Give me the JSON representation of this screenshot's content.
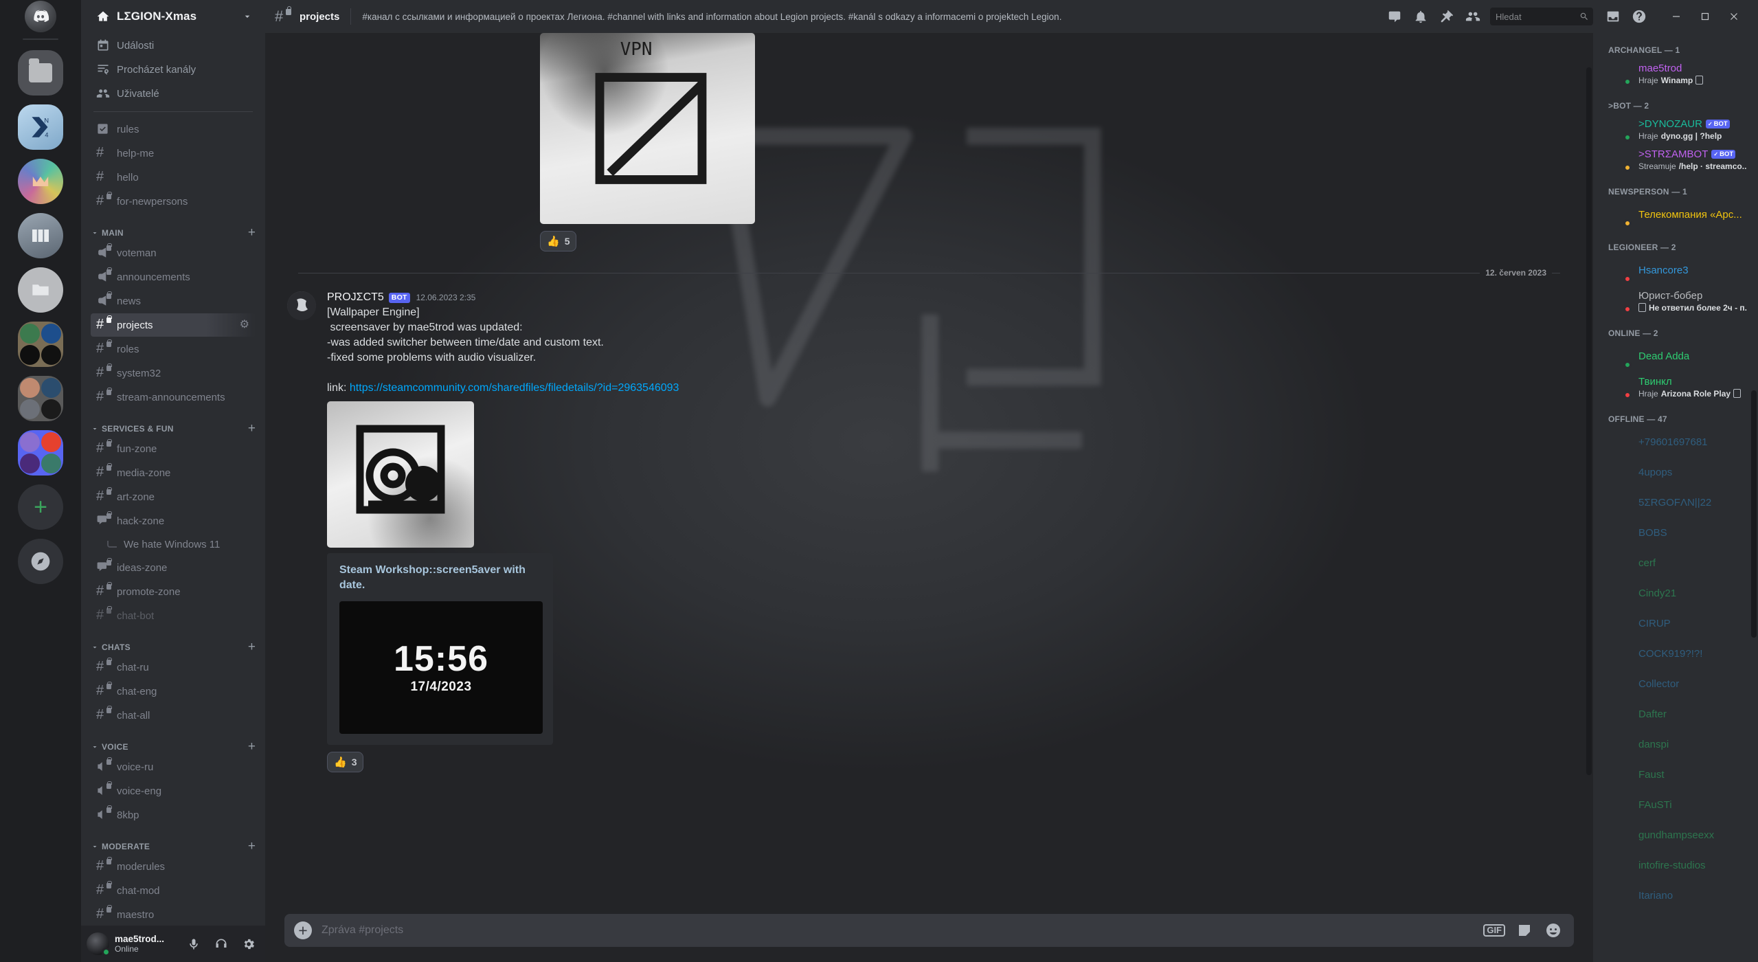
{
  "titlebar": {
    "server_name": "LΣGION-Xmas",
    "channel_name": "projects",
    "topic": "#канал с ссылками и информацией о проектах Легиона. #channel with links and information about Legion projects. #kanál s odkazy a informacemi o projektech Legion.",
    "search_placeholder": "Hledat",
    "icons": [
      "threads-icon",
      "notification-bell-icon",
      "pin-icon",
      "members-icon",
      "inbox-icon",
      "help-icon"
    ],
    "window_controls": [
      "minimize-icon",
      "maximize-icon",
      "close-icon"
    ]
  },
  "sidebar": {
    "nav": [
      {
        "label": "Události",
        "icon": "calendar-icon"
      },
      {
        "label": "Procházet kanály",
        "icon": "browse-channels-icon"
      },
      {
        "label": "Uživatelé",
        "icon": "members-icon"
      }
    ],
    "top_channels": [
      {
        "name": "rules",
        "icon": "rules-icon",
        "locked": false
      },
      {
        "name": "help-me",
        "icon": "hash",
        "locked": false
      },
      {
        "name": "hello",
        "icon": "hash",
        "locked": false
      },
      {
        "name": "for-newpersons",
        "icon": "hash",
        "locked": true
      }
    ],
    "categories": [
      {
        "name": "MAIN",
        "channels": [
          {
            "name": "voteman",
            "icon": "announcement",
            "locked": true
          },
          {
            "name": "announcements",
            "icon": "announcement",
            "locked": true
          },
          {
            "name": "news",
            "icon": "announcement",
            "locked": true
          },
          {
            "name": "projects",
            "icon": "hash",
            "locked": true,
            "active": true
          },
          {
            "name": "roles",
            "icon": "hash",
            "locked": true
          },
          {
            "name": "system32",
            "icon": "hash",
            "locked": true
          },
          {
            "name": "stream-announcements",
            "icon": "hash",
            "locked": true
          }
        ]
      },
      {
        "name": "SERVICES & FUN",
        "channels": [
          {
            "name": "fun-zone",
            "icon": "hash",
            "locked": true
          },
          {
            "name": "media-zone",
            "icon": "hash",
            "locked": true
          },
          {
            "name": "art-zone",
            "icon": "hash",
            "locked": true
          },
          {
            "name": "hack-zone",
            "icon": "forum",
            "locked": true
          },
          {
            "name": "We hate Windows 11",
            "icon": "thread",
            "thread": true
          },
          {
            "name": "ideas-zone",
            "icon": "forum",
            "locked": true
          },
          {
            "name": "promote-zone",
            "icon": "hash",
            "locked": true
          },
          {
            "name": "chat-bot",
            "icon": "hash",
            "locked": true,
            "muted": true
          }
        ]
      },
      {
        "name": "CHATS",
        "channels": [
          {
            "name": "chat-ru",
            "icon": "hash",
            "locked": true
          },
          {
            "name": "chat-eng",
            "icon": "hash",
            "locked": true
          },
          {
            "name": "chat-all",
            "icon": "hash",
            "locked": true
          }
        ]
      },
      {
        "name": "VOICE",
        "channels": [
          {
            "name": "voice-ru",
            "icon": "voice",
            "locked": true
          },
          {
            "name": "voice-eng",
            "icon": "voice",
            "locked": true
          },
          {
            "name": "8kbp",
            "icon": "voice",
            "locked": true
          }
        ]
      },
      {
        "name": "MODERATE",
        "channels": [
          {
            "name": "moderules",
            "icon": "hash",
            "locked": true
          },
          {
            "name": "chat-mod",
            "icon": "hash",
            "locked": true
          },
          {
            "name": "maestro",
            "icon": "hash",
            "locked": true
          }
        ]
      }
    ]
  },
  "user_panel": {
    "name": "mae5trod...",
    "status": "Online",
    "controls": [
      "microphone-icon",
      "headphones-icon",
      "settings-gear-icon"
    ]
  },
  "messages": {
    "date_divider": "12. červen 2023",
    "top_reaction": {
      "emoji": "👍",
      "count": "5"
    },
    "message": {
      "author": "PROJΣCT5",
      "bot_tag": "BOT",
      "timestamp": "12.06.2023 2:35",
      "lines": [
        "[Wallpaper Engine]",
        " screensaver by mae5trod was updated:",
        "-was added switcher between time/date and custom text.",
        "-fixed some problems with audio visualizer."
      ],
      "link_prefix": "link: ",
      "link_url": "https://steamcommunity.com/sharedfiles/filedetails/?id=2963546093",
      "embed": {
        "title": "Steam Workshop::screen5aver with date.",
        "image_clock": "15:56",
        "image_date": "17/4/2023"
      },
      "reaction": {
        "emoji": "👍",
        "count": "3"
      }
    }
  },
  "composer": {
    "placeholder": "Zpráva #projects",
    "gif_label": "GIF",
    "icons": [
      "gift-icon",
      "sticker-icon",
      "emoji-icon"
    ]
  },
  "members": {
    "groups": [
      {
        "title": "ARCHANGEL — 1",
        "members": [
          {
            "name": "mae5trod",
            "color": "#c162f0",
            "status": "online",
            "activity": "Hraje Winamp",
            "activity_bold": "Winamp",
            "activity_prefix": "Hraje ",
            "has_device_icon": true
          }
        ]
      },
      {
        "title": ">BOT — 2",
        "members": [
          {
            "name": ">DYNOZAUR",
            "color": "#1abc9c",
            "status": "online",
            "bot": true,
            "activity_prefix": "Hraje ",
            "activity_bold": "dyno.gg | ?help"
          },
          {
            "name": ">STRΣAMBOT",
            "color": "#c162f0",
            "status": "idle",
            "bot": true,
            "activity_prefix": "Streamuje ",
            "activity_bold": "/help · streamco..."
          }
        ]
      },
      {
        "title": "NEWSPERSON — 1",
        "members": [
          {
            "name": "Телекомпания «Арс...",
            "color": "#f1c40f",
            "status": "idle"
          }
        ]
      },
      {
        "title": "LEGIONEER — 2",
        "members": [
          {
            "name": "Hsancore3",
            "color": "#3498db",
            "status": "dnd"
          },
          {
            "name": "Юрист-бобер",
            "color": "#b9bbbe",
            "status": "dnd",
            "activity_bold": "Не ответил более 2ч - п...",
            "has_device_icon": true
          }
        ]
      },
      {
        "title": "ONLINE — 2",
        "members": [
          {
            "name": "Dead Adda",
            "color": "#2ecc71",
            "status": "online"
          },
          {
            "name": "Твинкл",
            "color": "#2ecc71",
            "status": "dnd",
            "activity_prefix": "Hraje ",
            "activity_bold": "Arizona Role Play",
            "has_device_icon": true
          }
        ]
      },
      {
        "title": "OFFLINE — 47",
        "offline": true,
        "members": [
          {
            "name": "+79601697681",
            "color": "#3498db"
          },
          {
            "name": "4upops",
            "color": "#3498db"
          },
          {
            "name": "5ΣRGOFΛN||22",
            "color": "#3498db"
          },
          {
            "name": "BOBS",
            "color": "#3498db"
          },
          {
            "name": "cerf",
            "color": "#2ecc71"
          },
          {
            "name": "Cindy21",
            "color": "#2ecc71"
          },
          {
            "name": "CIRUP",
            "color": "#3498db"
          },
          {
            "name": "COCK919?!?!",
            "color": "#3498db"
          },
          {
            "name": "Collector",
            "color": "#3498db"
          },
          {
            "name": "Dafter",
            "color": "#2ecc71"
          },
          {
            "name": "danspi",
            "color": "#2ecc71"
          },
          {
            "name": "Faust",
            "color": "#2ecc71"
          },
          {
            "name": "FAuSTi",
            "color": "#2ecc71"
          },
          {
            "name": "gundhampseexx",
            "color": "#2ecc71"
          },
          {
            "name": "intofire-studios",
            "color": "#2ecc71"
          },
          {
            "name": "Itariano",
            "color": "#3498db"
          }
        ]
      }
    ]
  },
  "colors": {
    "accent": "#5865f2",
    "online": "#23a55a",
    "idle": "#f0b232",
    "dnd": "#f23f43",
    "link": "#00a8fc"
  }
}
